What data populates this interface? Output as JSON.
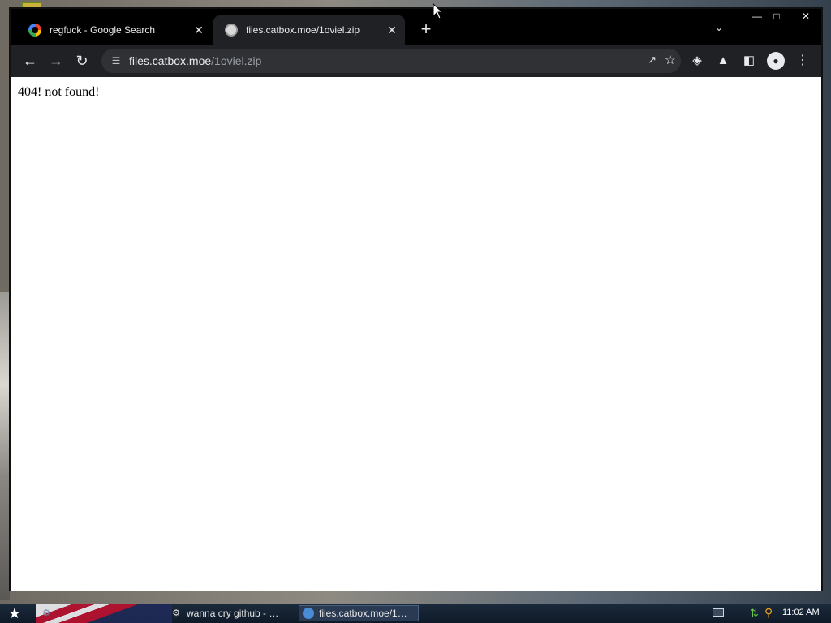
{
  "browser": {
    "tabs": [
      {
        "title": "regfuck - Google Search",
        "favicon": "google-g-icon",
        "active": false
      },
      {
        "title": "files.catbox.moe/1oviel.zip",
        "favicon": "catbox-icon",
        "active": true
      }
    ],
    "address": {
      "host": "files.catbox.moe",
      "path": "/1oviel.zip"
    }
  },
  "page": {
    "body_text": "404! not found!"
  },
  "taskbar": {
    "items": [
      {
        "label": "",
        "icon": "gear-icon"
      },
      {
        "label": "wanna cry github - …",
        "icon": "gear-icon"
      },
      {
        "label": "files.catbox.moe/1…",
        "icon": "chrome-icon"
      }
    ],
    "clock": "11:02 AM"
  },
  "colors": {
    "tab_active_bg": "#202124",
    "toolbar_bg": "#202124",
    "omnibox_bg": "#303134",
    "taskbar_bg": "#0f1a28"
  }
}
